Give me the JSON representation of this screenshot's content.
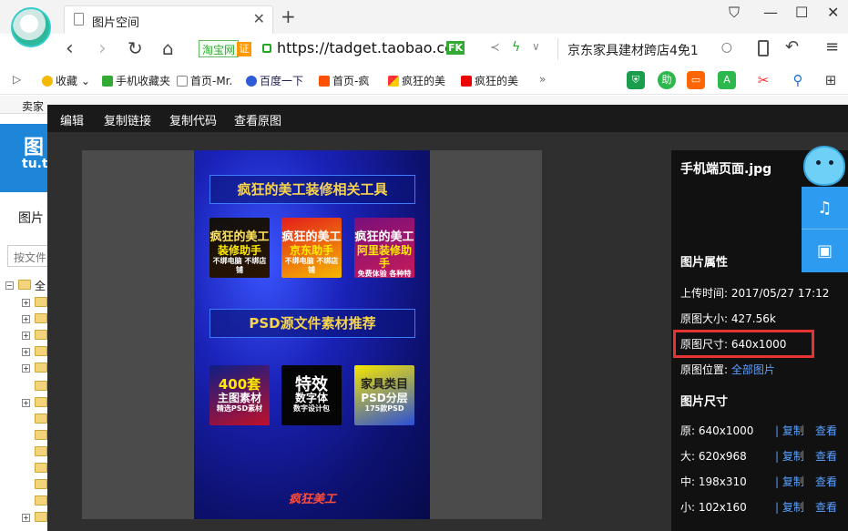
{
  "browser": {
    "tab_title": "图片空间",
    "url_tag": "淘宝网",
    "url_tag_badge": "证",
    "url": "https://tadget.taobao.cc",
    "fk_badge": "FK",
    "search_text": "京东家具建材跨店4免1"
  },
  "bookmarks": [
    {
      "label": "收藏",
      "icon": "star-icon"
    },
    {
      "label": "手机收藏夹",
      "icon": "phone-icon"
    },
    {
      "label": "首页-Mr.",
      "icon": "page-icon"
    },
    {
      "label": "百度一下",
      "icon": "baidu-icon"
    },
    {
      "label": "首页-疯",
      "icon": "taobao-icon"
    },
    {
      "label": "疯狂的美",
      "icon": "flag-icon"
    },
    {
      "label": "疯狂的美",
      "icon": "jd-icon"
    }
  ],
  "page": {
    "seller_strip": "卖家",
    "logo_line1": "图",
    "logo_line2": "tu.t",
    "pic_text": "图片",
    "file_search_placeholder": "按文件",
    "tree_root": "全"
  },
  "toolbar": {
    "edit": "编辑",
    "copy_link": "复制链接",
    "copy_code": "复制代码",
    "view_original": "查看原图"
  },
  "poster": {
    "title1": "疯狂的美工装修相关工具",
    "title2": "PSD源文件素材推荐",
    "tools": [
      {
        "top": "疯狂的美工",
        "mid": "装修助手",
        "sub": "不绑电脑 不绑店铺"
      },
      {
        "top": "疯狂的美工",
        "mid": "京东助手",
        "sub": "不绑电脑 不绑店铺"
      },
      {
        "top": "疯狂的美工",
        "mid": "阿里装修助手",
        "sub": "免费体验 各种特效一键生成"
      }
    ],
    "assets": [
      {
        "top": "400套",
        "mid": "主图素材",
        "sub": "精选PSD素材"
      },
      {
        "top": "特效",
        "mid": "数字体",
        "sub": "数字设计包"
      },
      {
        "top": "家具类目",
        "mid": "PSD分层",
        "sub": "175款PSD"
      }
    ],
    "footer": "疯狂美工"
  },
  "info": {
    "filename": "手机端页面.jpg",
    "attr_heading": "图片属性",
    "upload_time_label": "上传时间:",
    "upload_time": "2017/05/27 17:12",
    "size_label": "原图大小:",
    "size": "427.56k",
    "dim_label": "原图尺寸:",
    "dim": "640x1000",
    "loc_label": "原图位置:",
    "loc": "全部图片",
    "sizes_heading": "图片尺寸",
    "sizes": [
      {
        "label": "原:",
        "value": "640x1000"
      },
      {
        "label": "大:",
        "value": "620x968"
      },
      {
        "label": "中:",
        "value": "198x310"
      },
      {
        "label": "小:",
        "value": "102x160"
      }
    ],
    "copy": "复制",
    "view": "查看"
  },
  "colors": {
    "accent_blue": "#2d9bf0",
    "highlight_red": "#e53333",
    "link_blue": "#5aa0ff"
  }
}
